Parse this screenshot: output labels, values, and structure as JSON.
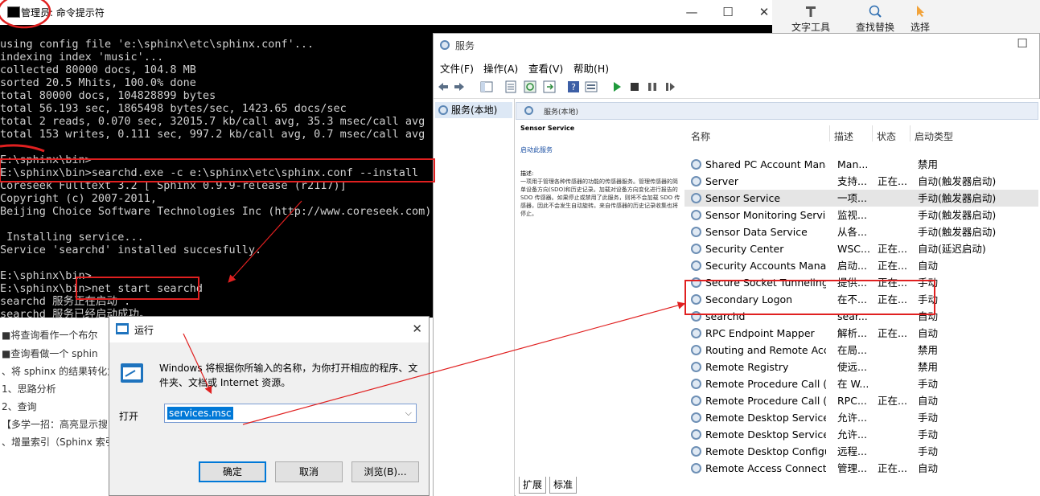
{
  "cmd": {
    "title": "管理员: 命令提示符",
    "lines": [
      "using config file 'e:\\sphinx\\etc\\sphinx.conf'...",
      "indexing index 'music'...",
      "collected 80000 docs, 104.8 MB",
      "sorted 20.5 Mhits, 100.0% done",
      "total 80000 docs, 104828899 bytes",
      "total 56.193 sec, 1865498 bytes/sec, 1423.65 docs/sec",
      "total 2 reads, 0.070 sec, 32015.7 kb/call avg, 35.3 msec/call avg",
      "total 153 writes, 0.111 sec, 997.2 kb/call avg, 0.7 msec/call avg",
      "",
      "E:\\sphinx\\bin>",
      "E:\\sphinx\\bin>searchd.exe -c e:\\sphinx\\etc\\sphinx.conf --install",
      "Coreseek Fulltext 3.2 [ Sphinx 0.9.9-release (r2117)]",
      "Copyright (c) 2007-2011,",
      "Beijing Choice Software Technologies Inc (http://www.coreseek.com)",
      "",
      " Installing service...",
      "Service 'searchd' installed succesfully.",
      "",
      "E:\\sphinx\\bin>",
      "E:\\sphinx\\bin>net start searchd",
      "searchd 服务正在启动 .",
      "searchd 服务已经启动成功。"
    ]
  },
  "doc_lines": [
    "■将查询看作一个布尔",
    "■查询看做一个 sphin",
    "、将 sphinx 的结果转化为",
    "1、思路分析",
    "2、查询",
    "【多学一招：高亮显示搜",
    "、增量索引（Sphinx 索引"
  ],
  "ribbon": {
    "text_tool": "文字工具",
    "find_replace": "查找替换",
    "select": "选择"
  },
  "services": {
    "title": "服务",
    "menu": [
      "文件(F)",
      "操作(A)",
      "查看(V)",
      "帮助(H)"
    ],
    "tree_item": "服务(本地)",
    "header": "服务(本地)",
    "desc_title": "Sensor Service",
    "desc_link": "启动此服务",
    "desc_label": "描述:",
    "desc_text": "一项用于管理各种传感器的功能的传感器服务。管理传感器的简单设备方向(SDO)和历史记录。加载对设备方向变化进行报告的 SDO 传感器。如果停止或禁用了此服务，则将不会加载 SDO 传感器，因此不会发生自动旋转。来自传感器的历史记录收集也将停止。",
    "columns": [
      "名称",
      "描述",
      "状态",
      "启动类型"
    ],
    "rows": [
      {
        "name": "Shared PC Account Mana...",
        "desc": "Man...",
        "status": "",
        "startup": "禁用"
      },
      {
        "name": "Server",
        "desc": "支持...",
        "status": "正在...",
        "startup": "自动(触发器启动)"
      },
      {
        "name": "Sensor Service",
        "desc": "一项...",
        "status": "",
        "startup": "手动(触发器启动)"
      },
      {
        "name": "Sensor Monitoring Service",
        "desc": "监视...",
        "status": "",
        "startup": "手动(触发器启动)"
      },
      {
        "name": "Sensor Data Service",
        "desc": "从各...",
        "status": "",
        "startup": "手动(触发器启动)"
      },
      {
        "name": "Security Center",
        "desc": "WSC...",
        "status": "正在...",
        "startup": "自动(延迟启动)"
      },
      {
        "name": "Security Accounts Manag...",
        "desc": "启动...",
        "status": "正在...",
        "startup": "自动"
      },
      {
        "name": "Secure Socket Tunneling ...",
        "desc": "提供...",
        "status": "正在...",
        "startup": "手动"
      },
      {
        "name": "Secondary Logon",
        "desc": "在不...",
        "status": "正在...",
        "startup": "手动"
      },
      {
        "name": "searchd",
        "desc": "sear...",
        "status": "",
        "startup": "自动"
      },
      {
        "name": "RPC Endpoint Mapper",
        "desc": "解析...",
        "status": "正在...",
        "startup": "自动"
      },
      {
        "name": "Routing and Remote Acc...",
        "desc": "在局...",
        "status": "",
        "startup": "禁用"
      },
      {
        "name": "Remote Registry",
        "desc": "使远...",
        "status": "",
        "startup": "禁用"
      },
      {
        "name": "Remote Procedure Call (...",
        "desc": "在 W...",
        "status": "",
        "startup": "手动"
      },
      {
        "name": "Remote Procedure Call (...",
        "desc": "RPC...",
        "status": "正在...",
        "startup": "自动"
      },
      {
        "name": "Remote Desktop Service...",
        "desc": "允许...",
        "status": "",
        "startup": "手动"
      },
      {
        "name": "Remote Desktop Services",
        "desc": "允许...",
        "status": "",
        "startup": "手动"
      },
      {
        "name": "Remote Desktop Configu...",
        "desc": "远程...",
        "status": "",
        "startup": "手动"
      },
      {
        "name": "Remote Access Connecti...",
        "desc": "管理...",
        "status": "正在...",
        "startup": "自动"
      }
    ],
    "selected_row": 2,
    "tabs": [
      "扩展",
      "标准"
    ]
  },
  "run": {
    "title": "运行",
    "description": "Windows 将根据你所输入的名称，为你打开相应的程序、文件夹、文档或 Internet 资源。",
    "open_label": "打开",
    "input_value": "services.msc",
    "ok": "确定",
    "cancel": "取消",
    "browse": "浏览(B)..."
  },
  "annotation_color": "#e02020"
}
